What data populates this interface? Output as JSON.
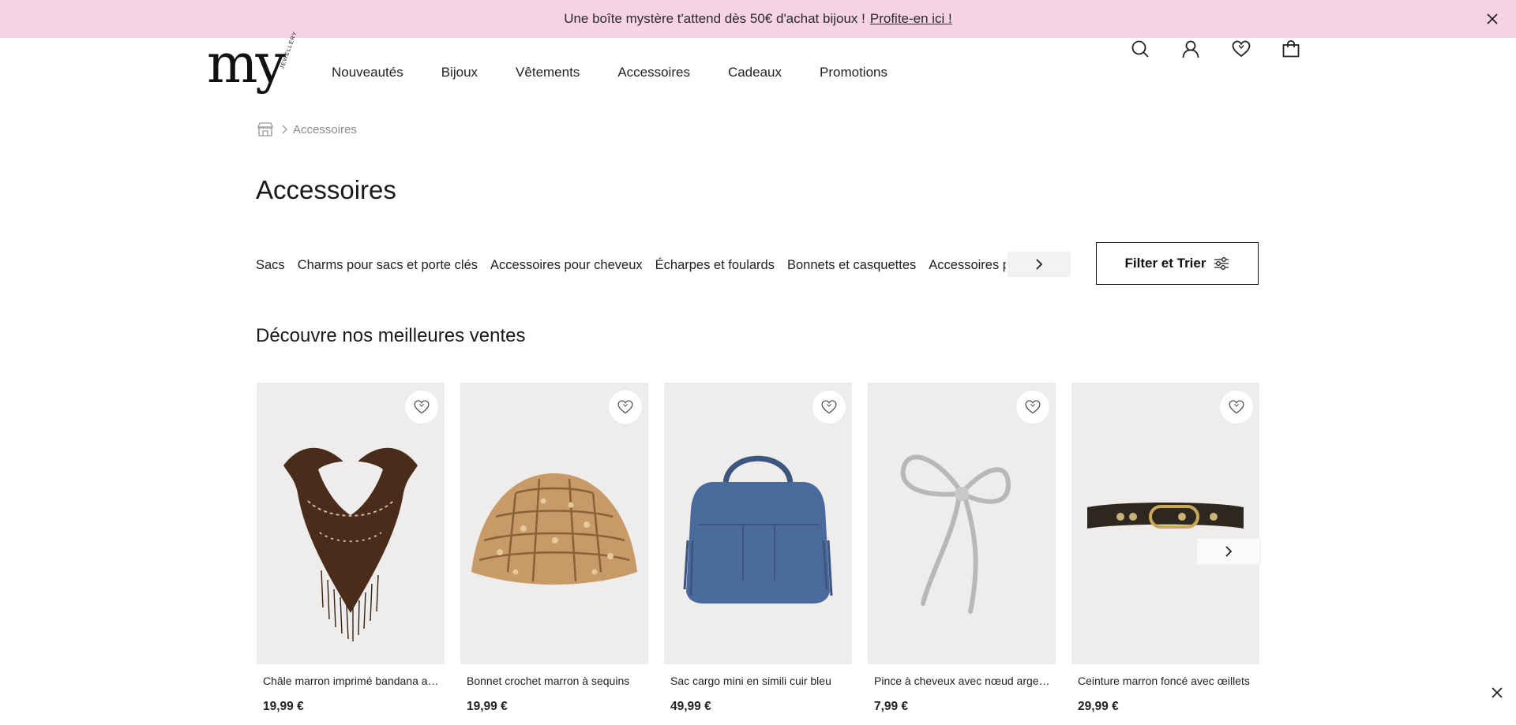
{
  "promo": {
    "text": "Une boîte mystère t'attend dès 50€ d'achat bijoux !",
    "link": "Profite-en ici !"
  },
  "header": {
    "logo_main": "my",
    "logo_sub": "JEWELLERY",
    "nav": [
      "Nouveautés",
      "Bijoux",
      "Vêtements",
      "Accessoires",
      "Cadeaux",
      "Promotions"
    ],
    "icons": [
      "search-icon",
      "account-icon",
      "wishlist-icon",
      "cart-icon"
    ]
  },
  "breadcrumb": {
    "home_icon": "shop-icon",
    "current": "Accessoires"
  },
  "page_title": "Accessoires",
  "categories": [
    "Sacs",
    "Charms pour sacs et porte clés",
    "Accessoires pour cheveux",
    "Écharpes et foulards",
    "Bonnets et casquettes",
    "Accessoires pour"
  ],
  "filter_button": "Filter et Trier",
  "section_title": "Découvre nos meilleures ventes",
  "products": [
    {
      "name": "Châle marron imprimé bandana av...",
      "price": "19,99 €"
    },
    {
      "name": "Bonnet crochet marron à sequins",
      "price": "19,99 €"
    },
    {
      "name": "Sac cargo mini en simili cuir bleu",
      "price": "49,99 €"
    },
    {
      "name": "Pince à cheveux avec nœud argenté",
      "price": "7,99 €"
    },
    {
      "name": "Ceinture marron foncé avec œillets",
      "price": "29,99 €"
    }
  ],
  "colors": {
    "promo_bg": "#f7d3e4",
    "product_bg": "#eeedeb",
    "text": "#1a1a1a"
  }
}
